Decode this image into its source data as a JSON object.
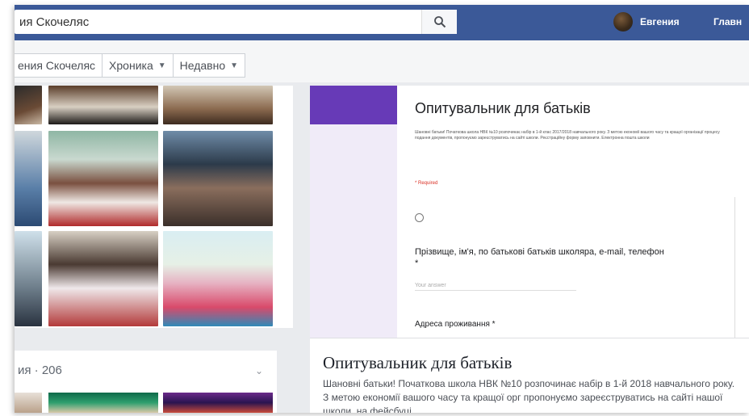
{
  "topbar": {
    "search_value": "ия Скочеляс",
    "user_name": "Евгения",
    "home_label": "Главн"
  },
  "subnav": {
    "items": [
      {
        "label": "ения Скочеляс",
        "has_caret": false
      },
      {
        "label": "Хроника",
        "has_caret": true
      },
      {
        "label": "Недавно",
        "has_caret": true
      }
    ]
  },
  "photos2": {
    "label": "ия · 206"
  },
  "form": {
    "title": "Опитувальник для батьків",
    "description": "Шановні батьки! Початкова школа НВК №10 розпочинає набір в 1-й клас 2017/2018 навчального року. З метою економії вашого часу та кращої організації процесу подання документів, пропонуємо зареєструватись на сайті школи. Реєстраційну форму заповнити. Електронна пошта школи",
    "required_note": "* Required",
    "question1": "Прізвище, ім'я, по батькові батьків школяра, e-mail, телефон",
    "question1_marker": "*",
    "answer_placeholder": "Your answer",
    "question2": "Адреса проживання *"
  },
  "link_preview": {
    "title": "Опитувальник для батьків",
    "description": "Шановні батьки! Початкова школа НВК №10 розпочинає набір в 1-й 2018 навчального року. З метою економії вашого часу та кращої орг пропонуємо зареєструватись на сайті нашої школи, на фейсбуці"
  },
  "colors": {
    "topbar": "#3b5998",
    "form_header": "#673ab7",
    "form_bg": "#f0ebf8"
  }
}
